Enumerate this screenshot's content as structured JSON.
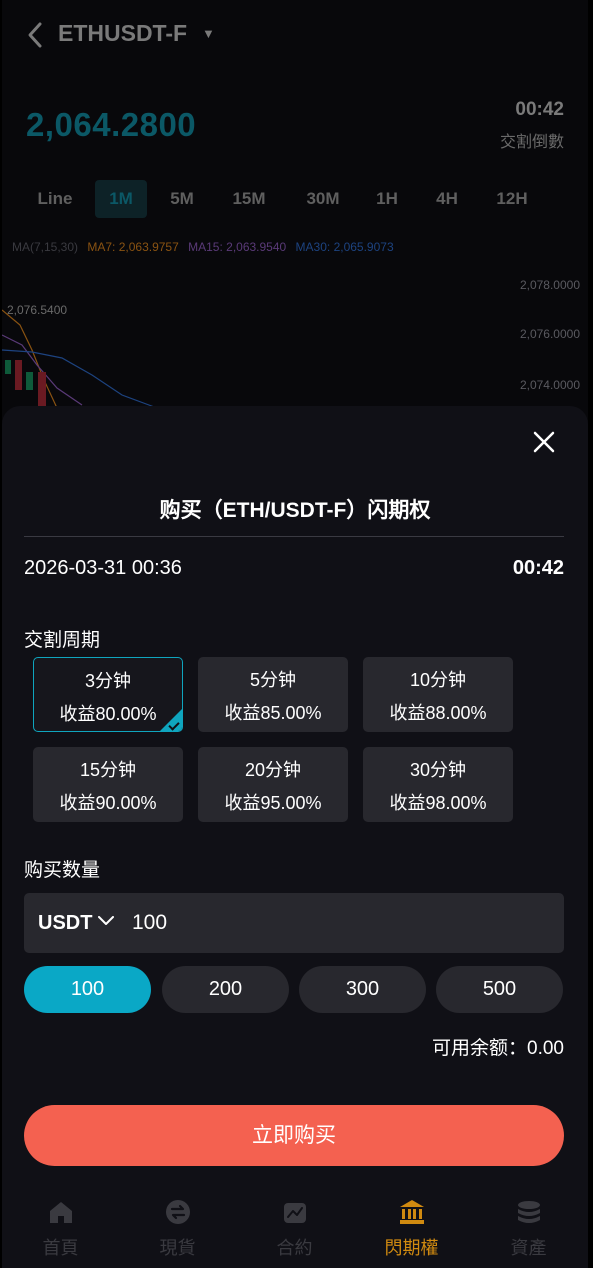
{
  "header": {
    "pair": "ETHUSDT-F",
    "price": "2,064.2800",
    "countdown": "00:42",
    "countdown_label": "交割倒數"
  },
  "intervals": [
    "Line",
    "1M",
    "5M",
    "15M",
    "30M",
    "1H",
    "4H",
    "12H"
  ],
  "active_interval": "1M",
  "ma": {
    "params": "MA(7,15,30)",
    "ma7": "MA7: 2,063.9757",
    "ma15": "MA15: 2,063.9540",
    "ma30": "MA30: 2,065.9073",
    "ma7_color": "#b56a12",
    "ma15_color": "#6a3f8a",
    "ma30_color": "#1d4f8a"
  },
  "chart": {
    "y_ticks": [
      "2,078.0000",
      "2,076.0000",
      "2,074.0000"
    ],
    "high_label": "2,076.5400"
  },
  "sheet": {
    "title": "购买（ETH/USDT-F）闪期权",
    "datetime": "2026-03-31 00:36",
    "countdown": "00:42",
    "period_label": "交割周期",
    "periods": [
      {
        "time": "3分钟",
        "yield": "收益80.00%"
      },
      {
        "time": "5分钟",
        "yield": "收益85.00%"
      },
      {
        "time": "10分钟",
        "yield": "收益88.00%"
      },
      {
        "time": "15分钟",
        "yield": "收益90.00%"
      },
      {
        "time": "20分钟",
        "yield": "收益95.00%"
      },
      {
        "time": "30分钟",
        "yield": "收益98.00%"
      }
    ],
    "quantity_label": "购买数量",
    "currency": "USDT",
    "amount": "100",
    "quick_amounts": [
      "100",
      "200",
      "300",
      "500"
    ],
    "balance": "可用余额：0.00",
    "buy_label": "立即购买"
  },
  "nav": [
    {
      "label": "首頁",
      "icon": "home-icon"
    },
    {
      "label": "現貨",
      "icon": "exchange-icon"
    },
    {
      "label": "合約",
      "icon": "contract-icon"
    },
    {
      "label": "閃期權",
      "icon": "bank-icon"
    },
    {
      "label": "資產",
      "icon": "coins-icon"
    }
  ],
  "colors": {
    "accent": "#0aa8c6",
    "buy": "#f46150",
    "nav_active": "#d08a10"
  }
}
